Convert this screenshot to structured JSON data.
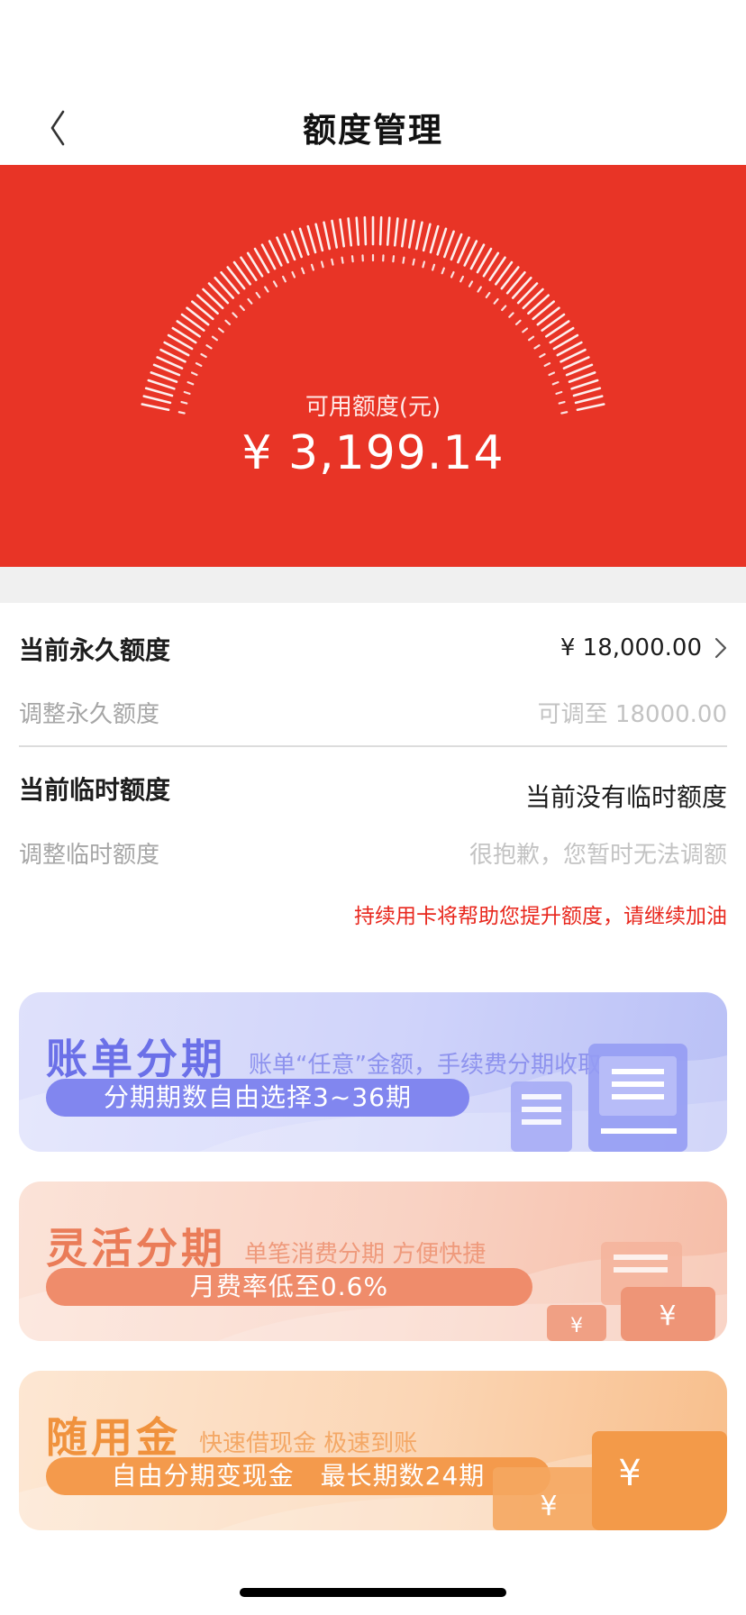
{
  "nav": {
    "title": "额度管理"
  },
  "hero": {
    "available_label": "可用额度(元)",
    "available_amount": "¥ 3,199.14"
  },
  "permanent": {
    "title": "当前永久额度",
    "value": "¥ 18,000.00",
    "adjust_label": "调整永久额度",
    "adjust_value": "可调至 18000.00"
  },
  "temporary": {
    "title": "当前临时额度",
    "value": "当前没有临时额度",
    "adjust_label": "调整临时额度",
    "adjust_value": "很抱歉，您暂时无法调额"
  },
  "notice": "持续用卡将帮助您提升额度，请继续加油",
  "cards": [
    {
      "title": "账单分期",
      "desc": "账单“任意”金额，手续费分期收取",
      "pill": "分期期数自由选择3~36期"
    },
    {
      "title": "灵活分期",
      "desc": "单笔消费分期 方便快捷",
      "pill": "月费率低至0.6%"
    },
    {
      "title": "随用金",
      "desc": "快速借现金 极速到账",
      "pill": "自由分期变现金　最长期数24期"
    }
  ],
  "colors": {
    "brand_red": "#e83426",
    "notice_red": "#e8271d",
    "card_blue": "#6b70e8",
    "card_peach": "#ea7c58",
    "card_orange": "#f0923d"
  },
  "icons": [
    "back-chevron-icon",
    "chevron-right-icon",
    "bill-document-icon",
    "yen-coin-icon"
  ]
}
